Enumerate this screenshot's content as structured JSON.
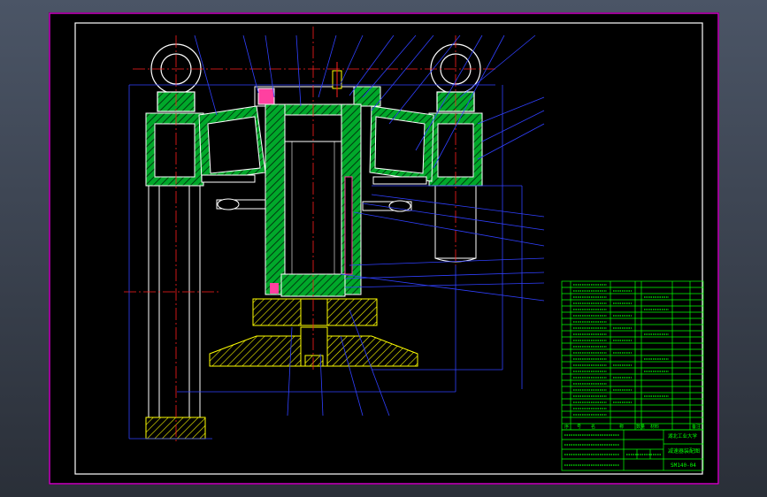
{
  "drawing": {
    "drawing_number": "SM140-04",
    "school_label": "湖北工业大学",
    "part_title": "减速器装配图"
  },
  "title_block": {
    "header_cells": [
      "序",
      "号",
      "名",
      "称",
      "数量",
      "材料",
      "备注"
    ]
  },
  "colors": {
    "background": "#000000",
    "frame": "#d000c8",
    "outline": "#ffffff",
    "hatch": "#00c832",
    "centerline": "#ff2020",
    "dimension": "#2030ff",
    "section": "#ffff00",
    "table": "#00ff00"
  }
}
